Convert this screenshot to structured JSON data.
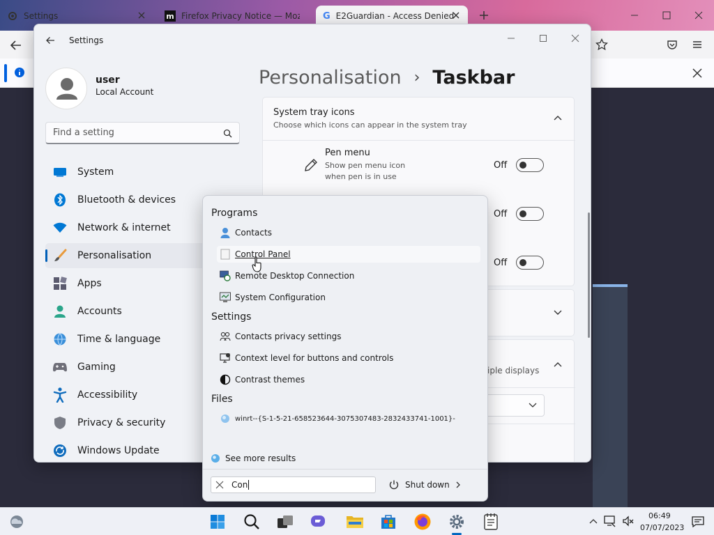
{
  "browser": {
    "tabs": [
      {
        "title": "Settings"
      },
      {
        "title": "Firefox Privacy Notice — Mozilla"
      },
      {
        "title": "E2Guardian - Access Denied"
      }
    ]
  },
  "settings": {
    "title": "Settings",
    "user": {
      "name": "user",
      "account_type": "Local Account"
    },
    "search_placeholder": "Find a setting",
    "breadcrumb": {
      "parent": "Personalisation",
      "separator": "›",
      "current": "Taskbar"
    },
    "nav_items": [
      {
        "label": "System",
        "icon": "monitor-icon"
      },
      {
        "label": "Bluetooth & devices",
        "icon": "bluetooth-icon"
      },
      {
        "label": "Network & internet",
        "icon": "wifi-icon"
      },
      {
        "label": "Personalisation",
        "icon": "brush-icon",
        "active": true
      },
      {
        "label": "Apps",
        "icon": "apps-icon"
      },
      {
        "label": "Accounts",
        "icon": "person-icon"
      },
      {
        "label": "Time & language",
        "icon": "globe-clock-icon"
      },
      {
        "label": "Gaming",
        "icon": "gamepad-icon"
      },
      {
        "label": "Accessibility",
        "icon": "accessibility-icon"
      },
      {
        "label": "Privacy & security",
        "icon": "shield-icon"
      },
      {
        "label": "Windows Update",
        "icon": "update-icon"
      }
    ],
    "system_tray": {
      "title": "System tray icons",
      "subtitle": "Choose which icons can appear in the system tray"
    },
    "pen_menu": {
      "title": "Pen menu",
      "description_line1": "Show pen menu icon",
      "description_line2": "when pen is in use",
      "state": "Off"
    },
    "toggle2_state": "Off",
    "toggle3_state": "Off",
    "partial_text": "iple displays"
  },
  "search": {
    "sections": {
      "programs": "Programs",
      "settings": "Settings",
      "files": "Files"
    },
    "programs": [
      {
        "label": "Contacts",
        "icon": "contacts-icon"
      },
      {
        "label": "Control Panel",
        "icon": "control-panel-icon"
      },
      {
        "label": "Remote Desktop Connection",
        "icon": "remote-desktop-icon"
      },
      {
        "label": "System Configuration",
        "icon": "system-config-icon"
      }
    ],
    "settings": [
      {
        "label": "Contacts privacy settings",
        "icon": "contacts-privacy-icon"
      },
      {
        "label": "Context level for buttons and controls",
        "icon": "context-level-icon"
      },
      {
        "label": "Contrast themes",
        "icon": "contrast-icon"
      }
    ],
    "files": [
      {
        "label": "winrt--{S-1-5-21-658523644-3075307483-2832433741-1001}-",
        "icon": "file-icon"
      }
    ],
    "see_more": "See more results",
    "query": "Con",
    "shutdown": "Shut down"
  },
  "taskbar": {
    "time": "06:49",
    "date": "07/07/2023"
  }
}
